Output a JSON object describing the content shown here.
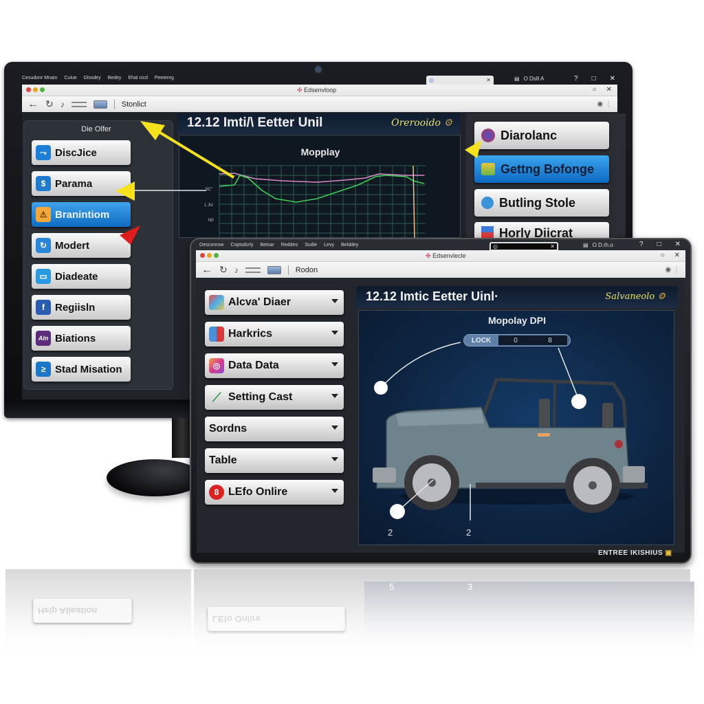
{
  "monitor": {
    "os_menu": [
      "Cesudonr Mnain",
      "Cuiue",
      "Dissdey",
      "Bedey",
      "Ehal cicd",
      "Peeienrg"
    ],
    "os_tab_label": "",
    "os_status": "O Ds8 A",
    "window_controls": [
      "?",
      "□",
      "✕"
    ],
    "browser": {
      "title": "Edsenvloop",
      "address": "Stonlict",
      "title_controls": [
        "○",
        "✕"
      ]
    },
    "sidebar": {
      "title": "Die Olfer",
      "items": [
        {
          "label": "DiscJice",
          "icon": "chart-window-icon",
          "icon_color": "#1c7fd6",
          "active": false
        },
        {
          "label": "Parama",
          "icon": "puzzle-icon",
          "icon_color": "#1f7ad0",
          "active": false
        },
        {
          "label": "Branintiom",
          "icon": "warning-icon",
          "icon_color": "#f2a93a",
          "active": true
        },
        {
          "label": "Modert",
          "icon": "refresh-icon",
          "icon_color": "#2a86d8",
          "active": false
        },
        {
          "label": "Diadeate",
          "icon": "message-icon",
          "icon_color": "#2a9ae0",
          "active": false
        },
        {
          "label": "Regiisln",
          "icon": "facebook-icon",
          "icon_color": "#2a5db0",
          "active": false
        },
        {
          "label": "Biations",
          "icon": "app-icon",
          "icon_color": "#5b2d7a",
          "active": false
        },
        {
          "label": "Stad Misation",
          "icon": "clipboard-icon",
          "icon_color": "#1b78c8",
          "active": false
        }
      ]
    },
    "center": {
      "title": "12.12 Imti/\\ Eetter Unil",
      "badge": "Orerooido",
      "chart": {
        "title": "Mopplay",
        "y_labels": [
          "5C\"",
          "1 J\\\\/",
          "N0"
        ]
      }
    },
    "rightbar": {
      "items": [
        {
          "label": "Diarolanc",
          "icon": "globe-icon",
          "active": false
        },
        {
          "label": "Gettng Bofonge",
          "icon": "dashboard-icon",
          "active": true
        },
        {
          "label": "Butling Stole",
          "icon": "globe-blue-icon",
          "active": false
        },
        {
          "label": "Horly Diicrat",
          "icon": "chart-red-icon",
          "active": false
        }
      ]
    }
  },
  "tablet": {
    "os_menu": [
      "Oesconrow",
      "Coptsdcrly",
      "Betsar",
      "Reddeo",
      "Sudie",
      "Levy",
      "Belddey"
    ],
    "os_status": "O D.rh.o",
    "window_controls": [
      "?",
      "□",
      "✕"
    ],
    "browser": {
      "title": "Edsenvlecle",
      "address": "Rodon",
      "title_controls": [
        "○",
        "✕"
      ]
    },
    "sidebar": {
      "items": [
        {
          "label": "Alcva' Diaer",
          "icon": "photos-icon"
        },
        {
          "label": "Harkrics",
          "icon": "calendar-icon"
        },
        {
          "label": "Data Data",
          "icon": "instagram-icon"
        },
        {
          "label": "Setting Cast",
          "icon": "wand-icon"
        },
        {
          "label": "Sordns",
          "icon": ""
        },
        {
          "label": "Table",
          "icon": ""
        },
        {
          "label": "LEfo Onlire",
          "icon": "help-icon"
        }
      ]
    },
    "main": {
      "title": "12.12 Imtic Eetter Uinl·",
      "badge": "Salvaneolo",
      "view_title": "Mopolay  DPI",
      "lock": {
        "label": "LOCK",
        "values": [
          "0",
          "8"
        ]
      },
      "callout_numbers": [
        "2",
        "2"
      ]
    },
    "footer": "ENTREE IKISHIUS"
  },
  "reflection": {
    "left_label": "Help Alieation",
    "right_label": "LEfo Onlire",
    "numbers": [
      "5",
      "3"
    ]
  },
  "colors": {
    "accent_blue": "#1780d6",
    "arrow_yellow": "#f5e21a",
    "arrow_red": "#e01d1d",
    "chart_green": "#3fcf5a",
    "chart_pink": "#d88ac8"
  }
}
